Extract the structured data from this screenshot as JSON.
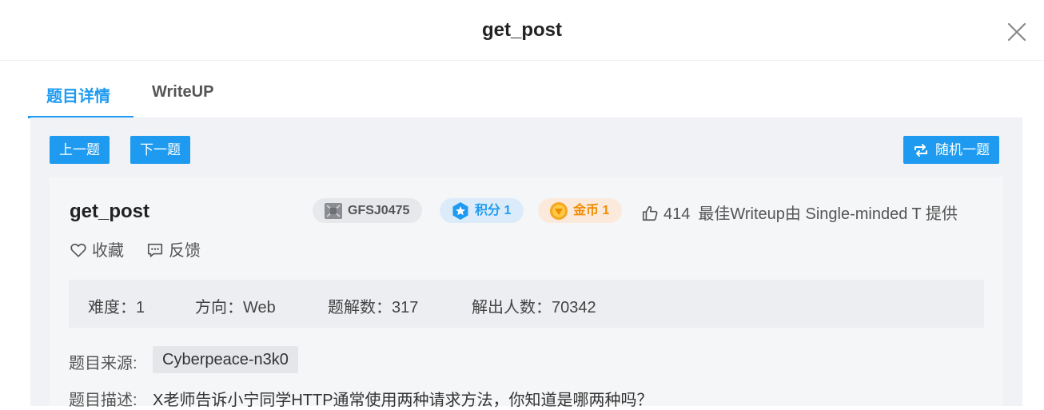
{
  "modal": {
    "title": "get_post"
  },
  "tabs": [
    {
      "label": "题目详情",
      "active": true
    },
    {
      "label": "WriteUP",
      "active": false
    }
  ],
  "nav": {
    "prev_label": "上一题",
    "next_label": "下一题",
    "random_label": "随机一题"
  },
  "challenge": {
    "title": "get_post",
    "id": "GFSJ0475",
    "score_label": "积分 1",
    "coin_label": "金币 1",
    "likes": "414",
    "best_writeup": "最佳Writeup由 Single-minded T 提供",
    "favorite_label": "收藏",
    "feedback_label": "反馈",
    "stats": {
      "difficulty": "难度：1",
      "direction": "方向：Web",
      "solutions": "题解数：317",
      "solvers": "解出人数：70342"
    },
    "source_label": "题目来源:",
    "source_value": "Cyberpeace-n3k0",
    "desc_label": "题目描述:",
    "desc_value": "X老师告诉小宁同学HTTP通常使用两种请求方法，你知道是哪两种吗？"
  },
  "colors": {
    "accent": "#1e9bf0",
    "coin": "#f08c00",
    "panel_bg": "#f0f2f5"
  },
  "icons": [
    "close-icon",
    "id-badge-icon",
    "star-badge-icon",
    "coin-icon",
    "thumbs-up-icon",
    "heart-icon",
    "feedback-icon",
    "shuffle-icon"
  ]
}
